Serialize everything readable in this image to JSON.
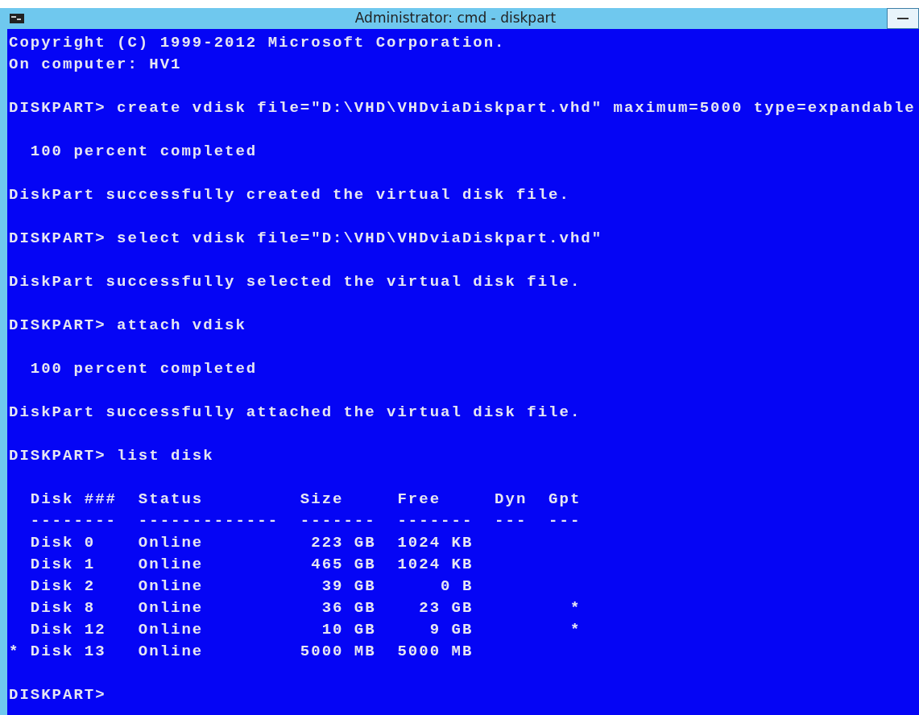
{
  "window": {
    "title": "Administrator: cmd - diskpart"
  },
  "console_blocks": [
    [
      "Copyright (C) 1999-2012 Microsoft Corporation.",
      "On computer: HV1"
    ],
    [
      "DISKPART> create vdisk file=\"D:\\VHD\\VHDviaDiskpart.vhd\" maximum=5000 type=expandable"
    ],
    [
      "  100 percent completed"
    ],
    [
      "DiskPart successfully created the virtual disk file."
    ],
    [
      "DISKPART> select vdisk file=\"D:\\VHD\\VHDviaDiskpart.vhd\""
    ],
    [
      "DiskPart successfully selected the virtual disk file."
    ],
    [
      "DISKPART> attach vdisk"
    ],
    [
      "  100 percent completed"
    ],
    [
      "DiskPart successfully attached the virtual disk file."
    ],
    [
      "DISKPART> list disk"
    ],
    [
      "  Disk ###  Status         Size     Free     Dyn  Gpt",
      "  --------  -------------  -------  -------  ---  ---",
      "  Disk 0    Online          223 GB  1024 KB",
      "  Disk 1    Online          465 GB  1024 KB",
      "  Disk 2    Online           39 GB      0 B",
      "  Disk 8    Online           36 GB    23 GB         *",
      "  Disk 12   Online           10 GB     9 GB         *",
      "* Disk 13   Online         5000 MB  5000 MB"
    ],
    [
      "DISKPART>"
    ]
  ]
}
